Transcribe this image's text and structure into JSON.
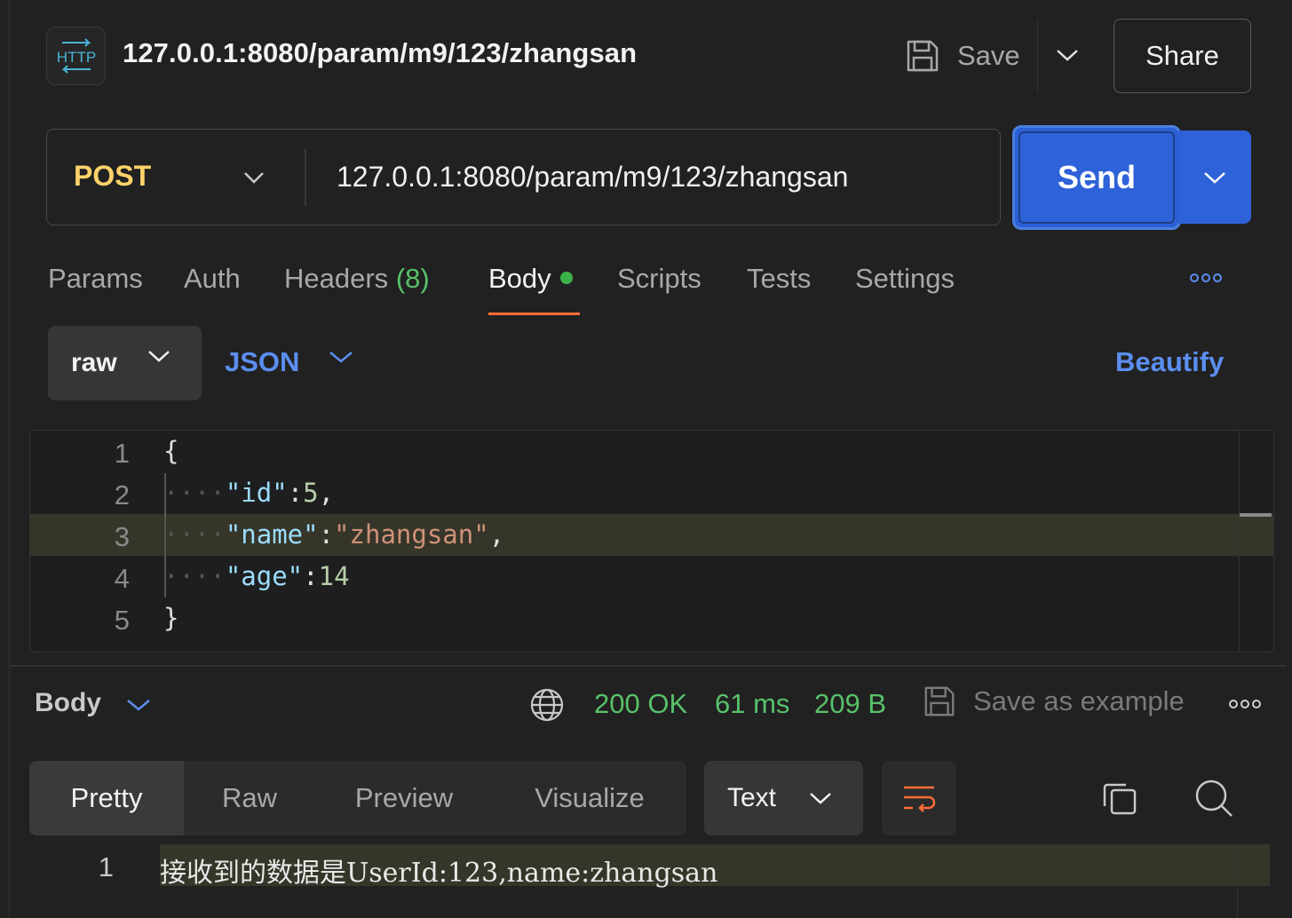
{
  "header": {
    "badge": "HTTP",
    "title": "127.0.0.1:8080/param/m9/123/zhangsan",
    "save_label": "Save",
    "share_label": "Share"
  },
  "request": {
    "method": "POST",
    "url": "127.0.0.1:8080/param/m9/123/zhangsan",
    "send_label": "Send"
  },
  "tabs": [
    {
      "label": "Params"
    },
    {
      "label": "Auth"
    },
    {
      "label": "Headers",
      "count": "(8)"
    },
    {
      "label": "Body",
      "active": true,
      "indicator": "green-dot"
    },
    {
      "label": "Scripts"
    },
    {
      "label": "Tests"
    },
    {
      "label": "Settings"
    }
  ],
  "body_options": {
    "mode": "raw",
    "language": "JSON",
    "beautify_label": "Beautify"
  },
  "editor": {
    "lines": [
      {
        "n": "1",
        "text": "{"
      },
      {
        "n": "2",
        "key": "\"id\"",
        "sep": ":",
        "value": "5",
        "tail": ","
      },
      {
        "n": "3",
        "key": "\"name\"",
        "sep": ":",
        "value": "\"zhangsan\"",
        "tail": ","
      },
      {
        "n": "4",
        "key": "\"age\"",
        "sep": ":",
        "value": "14",
        "tail": ""
      },
      {
        "n": "5",
        "text": "}"
      }
    ]
  },
  "response": {
    "label": "Body",
    "status": "200 OK",
    "time": "61 ms",
    "size": "209 B",
    "save_example_label": "Save as example",
    "views": [
      "Pretty",
      "Raw",
      "Preview",
      "Visualize"
    ],
    "active_view": "Pretty",
    "format": "Text",
    "line_number": "1",
    "content": "接收到的数据是UserId:123,name:zhangsan"
  },
  "colors": {
    "background": "#212121",
    "method": "#ffd36b",
    "send": "#2e62d8",
    "link": "#5b8ef0",
    "success": "#58c16a",
    "tab_underline": "#ff6c37"
  }
}
